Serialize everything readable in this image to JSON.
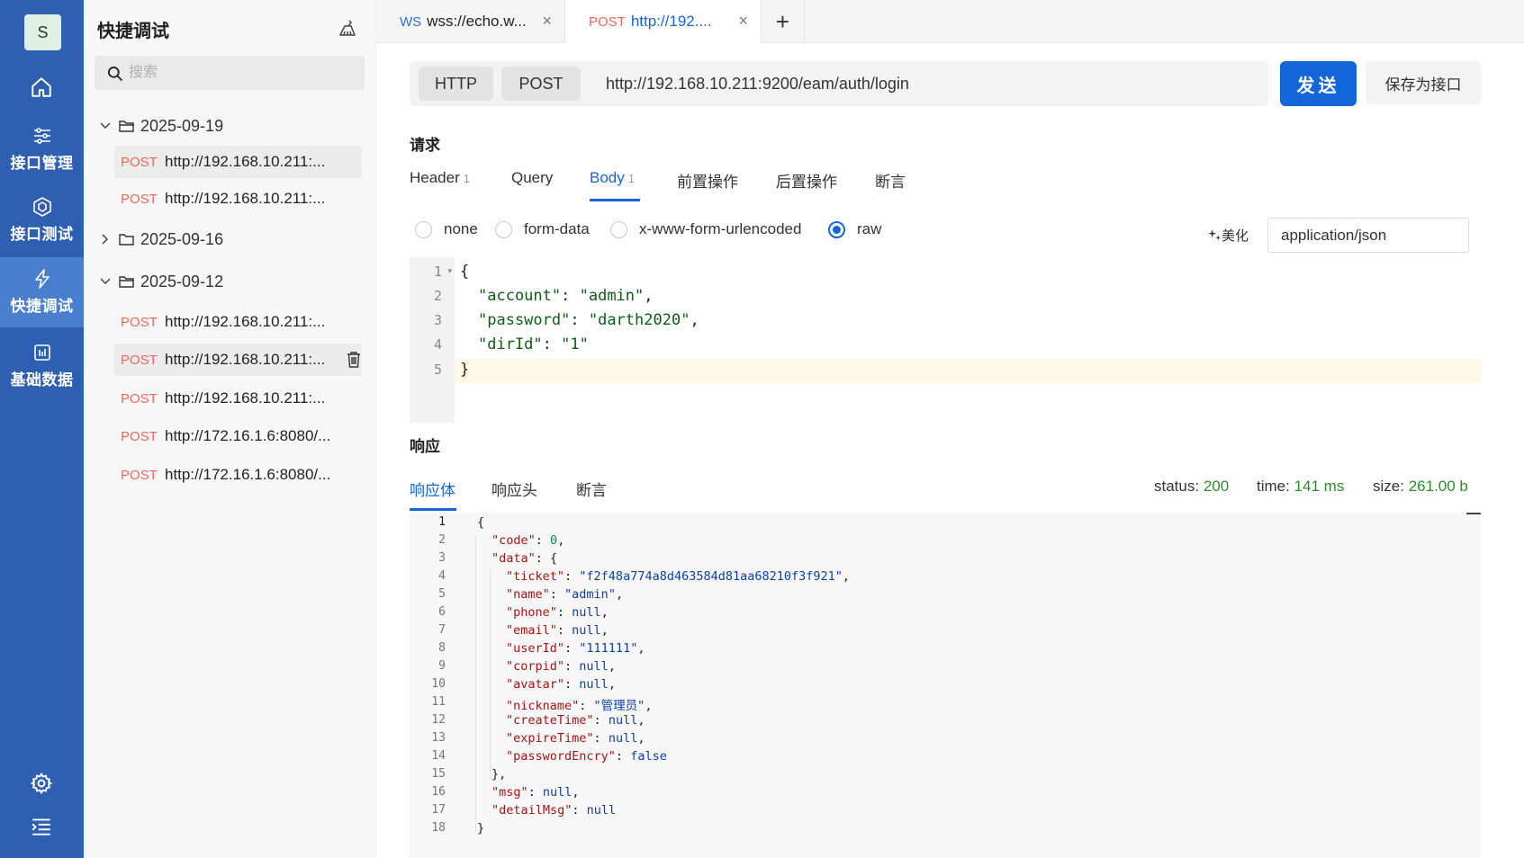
{
  "rail": {
    "avatar": "S",
    "items": [
      {
        "label": "接口管理"
      },
      {
        "label": "接口测试"
      },
      {
        "label": "快捷调试"
      },
      {
        "label": "基础数据"
      }
    ]
  },
  "panel": {
    "title": "快捷调试",
    "search_placeholder": "搜索",
    "groups": [
      {
        "date": "2025-09-19"
      },
      {
        "date": "2025-09-16"
      },
      {
        "date": "2025-09-12"
      }
    ],
    "requests": [
      {
        "method": "POST",
        "url": "http://192.168.10.211:..."
      },
      {
        "method": "POST",
        "url": "http://192.168.10.211:..."
      },
      {
        "method": "POST",
        "url": "http://192.168.10.211:..."
      },
      {
        "method": "POST",
        "url": "http://192.168.10.211:..."
      },
      {
        "method": "POST",
        "url": "http://192.168.10.211:..."
      },
      {
        "method": "POST",
        "url": "http://172.16.1.6:8080/..."
      },
      {
        "method": "POST",
        "url": "http://172.16.1.6:8080/..."
      }
    ]
  },
  "tabs": [
    {
      "prefix": "WS",
      "title": "wss://echo.w...",
      "close": "×"
    },
    {
      "prefix": "POST",
      "title": "http://192....",
      "close": "×"
    }
  ],
  "tab_add": "+",
  "urlbar": {
    "protocol": "HTTP",
    "method": "POST",
    "url": "http://192.168.10.211:9200/eam/auth/login",
    "send": "发送",
    "save": "保存为接口"
  },
  "request": {
    "section": "请求",
    "tabs": [
      {
        "label": "Header",
        "count": "1"
      },
      {
        "label": "Query",
        "count": ""
      },
      {
        "label": "Body",
        "count": "1"
      },
      {
        "label": "前置操作",
        "count": ""
      },
      {
        "label": "后置操作",
        "count": ""
      },
      {
        "label": "断言",
        "count": ""
      }
    ],
    "body_types": [
      "none",
      "form-data",
      "x-www-form-urlencoded",
      "raw"
    ],
    "selected_body_type": "raw",
    "beautify": "美化",
    "content_type": "application/json",
    "line_numbers": [
      "1",
      "2",
      "3",
      "4",
      "5"
    ],
    "body_lines": [
      {
        "text": "{"
      },
      {
        "key": "\"account\"",
        "value": "\"admin\"",
        "sep": ": ",
        "end": ","
      },
      {
        "key": "\"password\"",
        "value": "\"darth2020\"",
        "sep": ": ",
        "end": ","
      },
      {
        "key": "\"dirId\"",
        "value": "\"1\"",
        "sep": ": ",
        "end": ""
      },
      {
        "text": "}"
      }
    ]
  },
  "response": {
    "section": "响应",
    "tabs": [
      "响应体",
      "响应头",
      "断言"
    ],
    "status_label": "status:",
    "status": "200",
    "time_label": "time:",
    "time": "141 ms",
    "size_label": "size:",
    "size": "261.00 b",
    "lines": [
      "{",
      "\"code\": 0,",
      "\"data\": {",
      "\"ticket\": \"f2f48a774a8d463584d81aa68210f3f921\",",
      "\"name\": \"admin\",",
      "\"phone\": null,",
      "\"email\": null,",
      "\"userId\": \"111111\",",
      "\"corpid\": null,",
      "\"avatar\": null,",
      "\"nickname\": \"管理员\",",
      "\"createTime\": null,",
      "\"expireTime\": null,",
      "\"passwordEncry\": false",
      "},",
      "\"msg\": null,",
      "\"detailMsg\": null",
      "}"
    ]
  },
  "colors": {
    "rail": "#2f5fb0",
    "rail_active": "#4a7fd0",
    "accent": "#1466d8",
    "method_post": "#f0665e",
    "status_value": "#2c8c2c"
  }
}
